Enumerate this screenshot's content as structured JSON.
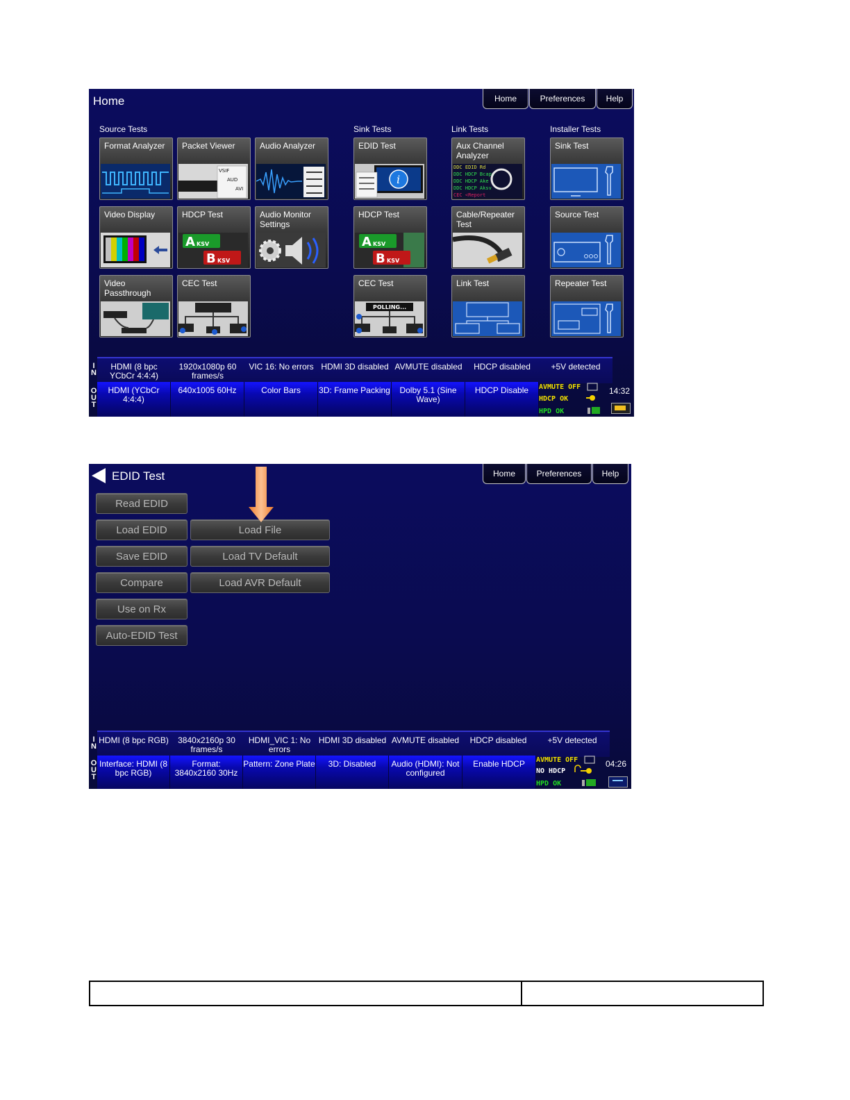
{
  "home": {
    "title": "Home",
    "nav": [
      "Home",
      "Preferences",
      "Help"
    ],
    "categories": {
      "source": "Source Tests",
      "sink": "Sink Tests",
      "link": "Link Tests",
      "installer": "Installer Tests"
    },
    "tiles": {
      "format_analyzer": "Format Analyzer",
      "packet_viewer": "Packet Viewer",
      "audio_analyzer": "Audio Analyzer",
      "edid_test": "EDID Test",
      "aux_channel": "Aux Channel Analyzer",
      "sink_test": "Sink Test",
      "video_display": "Video Display",
      "hdcp_test_src": "HDCP Test",
      "audio_monitor": "Audio Monitor Settings",
      "hdcp_test_sink": "HDCP Test",
      "cable_repeater": "Cable/Repeater Test",
      "source_test": "Source Test",
      "video_passthrough": "Video Passthrough",
      "cec_test_src": "CEC Test",
      "cec_test_sink": "CEC Test",
      "link_test": "Link Test",
      "repeater_test": "Repeater Test"
    },
    "tile_art_text": {
      "packet": [
        "VSIF",
        "AUD",
        "AVI"
      ],
      "aksv": "A",
      "bksv": "B",
      "ksv": "KSV",
      "polling": "POLLING...",
      "aux": [
        "DDC EDID Rd",
        "DDC HDCP Bcaps",
        "DDC HDCP Ake",
        "DDC HDCP Aksv",
        "CEC <Report"
      ]
    },
    "in_row": [
      "HDMI (8 bpc YCbCr 4:4:4)",
      "1920x1080p 60 frames/s",
      "VIC 16: No errors",
      "HDMI 3D disabled",
      "AVMUTE disabled",
      "HDCP disabled",
      "+5V detected"
    ],
    "out_row": [
      "HDMI (YCbCr 4:4:4)",
      "640x1005 60Hz",
      "Color Bars",
      "3D: Frame Packing",
      "Dolby 5.1 (Sine Wave)",
      "HDCP Disable"
    ],
    "indicators": [
      "AVMUTE OFF",
      "HDCP OK",
      "HPD OK"
    ],
    "time": "14:32",
    "side_in": [
      "I",
      "N"
    ],
    "side_out": [
      "O",
      "U",
      "T"
    ]
  },
  "edid": {
    "title": "EDID Test",
    "nav": [
      "Home",
      "Preferences",
      "Help"
    ],
    "left_buttons": [
      "Read EDID",
      "Load EDID",
      "Save EDID",
      "Compare",
      "Use on Rx",
      "Auto-EDID Test"
    ],
    "right_buttons": [
      "Load File",
      "Load TV Default",
      "Load AVR Default"
    ],
    "in_row": [
      "HDMI (8 bpc RGB)",
      "3840x2160p 30 frames/s",
      "HDMI_VIC 1: No errors",
      "HDMI 3D disabled",
      "AVMUTE disabled",
      "HDCP disabled",
      "+5V detected"
    ],
    "out_row": [
      "Interface: HDMI (8 bpc RGB)",
      "Format: 3840x2160 30Hz",
      "Pattern: Zone Plate",
      "3D: Disabled",
      "Audio (HDMI): Not configured",
      "Enable HDCP"
    ],
    "indicators": [
      "AVMUTE OFF",
      "NO HDCP",
      "HPD OK"
    ],
    "time": "04:26",
    "side_in": [
      "I",
      "N"
    ],
    "side_out": [
      "O",
      "U",
      "T"
    ]
  },
  "colors": {
    "screen_bg": "#0a0b4f",
    "avmute_yellow": "#f2e000",
    "hpd_green": "#22dd22",
    "hdcp_ok_yellow": "#f2e000",
    "no_hdcp_white": "#ffffff",
    "arrow_orange": "#f5a05a"
  }
}
